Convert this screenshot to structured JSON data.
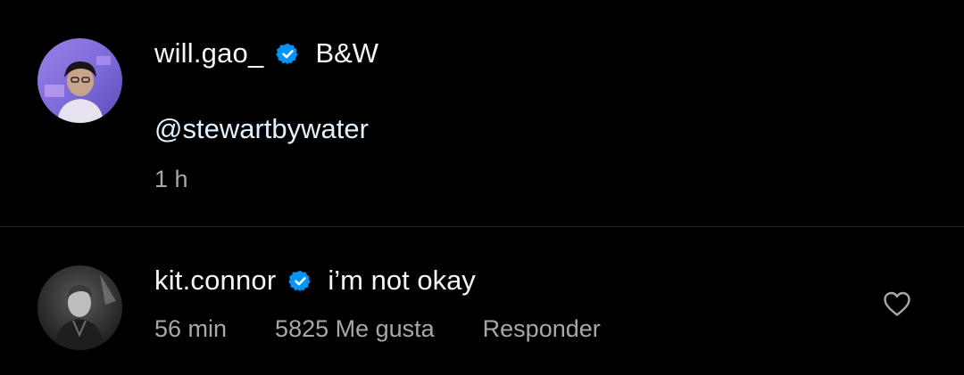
{
  "comments": [
    {
      "username": "will.gao_",
      "verified": true,
      "avatar_icon": "avatar-photo-will-gao",
      "text": "B&W",
      "mention": "@stewartbywater",
      "time": "1 h"
    },
    {
      "username": "kit.connor",
      "verified": true,
      "avatar_icon": "avatar-photo-kit-connor",
      "text": "i’m not okay",
      "time": "56 min",
      "likes": "5825 Me gusta",
      "reply_label": "Responder",
      "like_icon": "heart-outline-icon"
    }
  ],
  "colors": {
    "background": "#000000",
    "text": "#f5f5f5",
    "secondary_text": "#a8a8a8",
    "mention": "#e0f1ff",
    "verified_badge": "#0095f6",
    "divider": "#262626"
  }
}
